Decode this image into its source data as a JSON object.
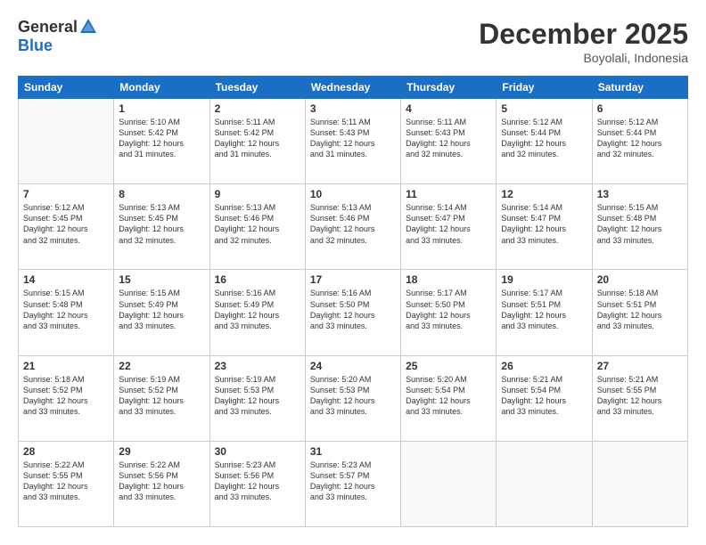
{
  "header": {
    "logo_general": "General",
    "logo_blue": "Blue",
    "month_year": "December 2025",
    "location": "Boyolali, Indonesia"
  },
  "days_of_week": [
    "Sunday",
    "Monday",
    "Tuesday",
    "Wednesday",
    "Thursday",
    "Friday",
    "Saturday"
  ],
  "weeks": [
    [
      {
        "day": "",
        "info": ""
      },
      {
        "day": "1",
        "info": "Sunrise: 5:10 AM\nSunset: 5:42 PM\nDaylight: 12 hours\nand 31 minutes."
      },
      {
        "day": "2",
        "info": "Sunrise: 5:11 AM\nSunset: 5:42 PM\nDaylight: 12 hours\nand 31 minutes."
      },
      {
        "day": "3",
        "info": "Sunrise: 5:11 AM\nSunset: 5:43 PM\nDaylight: 12 hours\nand 31 minutes."
      },
      {
        "day": "4",
        "info": "Sunrise: 5:11 AM\nSunset: 5:43 PM\nDaylight: 12 hours\nand 32 minutes."
      },
      {
        "day": "5",
        "info": "Sunrise: 5:12 AM\nSunset: 5:44 PM\nDaylight: 12 hours\nand 32 minutes."
      },
      {
        "day": "6",
        "info": "Sunrise: 5:12 AM\nSunset: 5:44 PM\nDaylight: 12 hours\nand 32 minutes."
      }
    ],
    [
      {
        "day": "7",
        "info": "Sunrise: 5:12 AM\nSunset: 5:45 PM\nDaylight: 12 hours\nand 32 minutes."
      },
      {
        "day": "8",
        "info": "Sunrise: 5:13 AM\nSunset: 5:45 PM\nDaylight: 12 hours\nand 32 minutes."
      },
      {
        "day": "9",
        "info": "Sunrise: 5:13 AM\nSunset: 5:46 PM\nDaylight: 12 hours\nand 32 minutes."
      },
      {
        "day": "10",
        "info": "Sunrise: 5:13 AM\nSunset: 5:46 PM\nDaylight: 12 hours\nand 32 minutes."
      },
      {
        "day": "11",
        "info": "Sunrise: 5:14 AM\nSunset: 5:47 PM\nDaylight: 12 hours\nand 33 minutes."
      },
      {
        "day": "12",
        "info": "Sunrise: 5:14 AM\nSunset: 5:47 PM\nDaylight: 12 hours\nand 33 minutes."
      },
      {
        "day": "13",
        "info": "Sunrise: 5:15 AM\nSunset: 5:48 PM\nDaylight: 12 hours\nand 33 minutes."
      }
    ],
    [
      {
        "day": "14",
        "info": "Sunrise: 5:15 AM\nSunset: 5:48 PM\nDaylight: 12 hours\nand 33 minutes."
      },
      {
        "day": "15",
        "info": "Sunrise: 5:15 AM\nSunset: 5:49 PM\nDaylight: 12 hours\nand 33 minutes."
      },
      {
        "day": "16",
        "info": "Sunrise: 5:16 AM\nSunset: 5:49 PM\nDaylight: 12 hours\nand 33 minutes."
      },
      {
        "day": "17",
        "info": "Sunrise: 5:16 AM\nSunset: 5:50 PM\nDaylight: 12 hours\nand 33 minutes."
      },
      {
        "day": "18",
        "info": "Sunrise: 5:17 AM\nSunset: 5:50 PM\nDaylight: 12 hours\nand 33 minutes."
      },
      {
        "day": "19",
        "info": "Sunrise: 5:17 AM\nSunset: 5:51 PM\nDaylight: 12 hours\nand 33 minutes."
      },
      {
        "day": "20",
        "info": "Sunrise: 5:18 AM\nSunset: 5:51 PM\nDaylight: 12 hours\nand 33 minutes."
      }
    ],
    [
      {
        "day": "21",
        "info": "Sunrise: 5:18 AM\nSunset: 5:52 PM\nDaylight: 12 hours\nand 33 minutes."
      },
      {
        "day": "22",
        "info": "Sunrise: 5:19 AM\nSunset: 5:52 PM\nDaylight: 12 hours\nand 33 minutes."
      },
      {
        "day": "23",
        "info": "Sunrise: 5:19 AM\nSunset: 5:53 PM\nDaylight: 12 hours\nand 33 minutes."
      },
      {
        "day": "24",
        "info": "Sunrise: 5:20 AM\nSunset: 5:53 PM\nDaylight: 12 hours\nand 33 minutes."
      },
      {
        "day": "25",
        "info": "Sunrise: 5:20 AM\nSunset: 5:54 PM\nDaylight: 12 hours\nand 33 minutes."
      },
      {
        "day": "26",
        "info": "Sunrise: 5:21 AM\nSunset: 5:54 PM\nDaylight: 12 hours\nand 33 minutes."
      },
      {
        "day": "27",
        "info": "Sunrise: 5:21 AM\nSunset: 5:55 PM\nDaylight: 12 hours\nand 33 minutes."
      }
    ],
    [
      {
        "day": "28",
        "info": "Sunrise: 5:22 AM\nSunset: 5:55 PM\nDaylight: 12 hours\nand 33 minutes."
      },
      {
        "day": "29",
        "info": "Sunrise: 5:22 AM\nSunset: 5:56 PM\nDaylight: 12 hours\nand 33 minutes."
      },
      {
        "day": "30",
        "info": "Sunrise: 5:23 AM\nSunset: 5:56 PM\nDaylight: 12 hours\nand 33 minutes."
      },
      {
        "day": "31",
        "info": "Sunrise: 5:23 AM\nSunset: 5:57 PM\nDaylight: 12 hours\nand 33 minutes."
      },
      {
        "day": "",
        "info": ""
      },
      {
        "day": "",
        "info": ""
      },
      {
        "day": "",
        "info": ""
      }
    ]
  ]
}
